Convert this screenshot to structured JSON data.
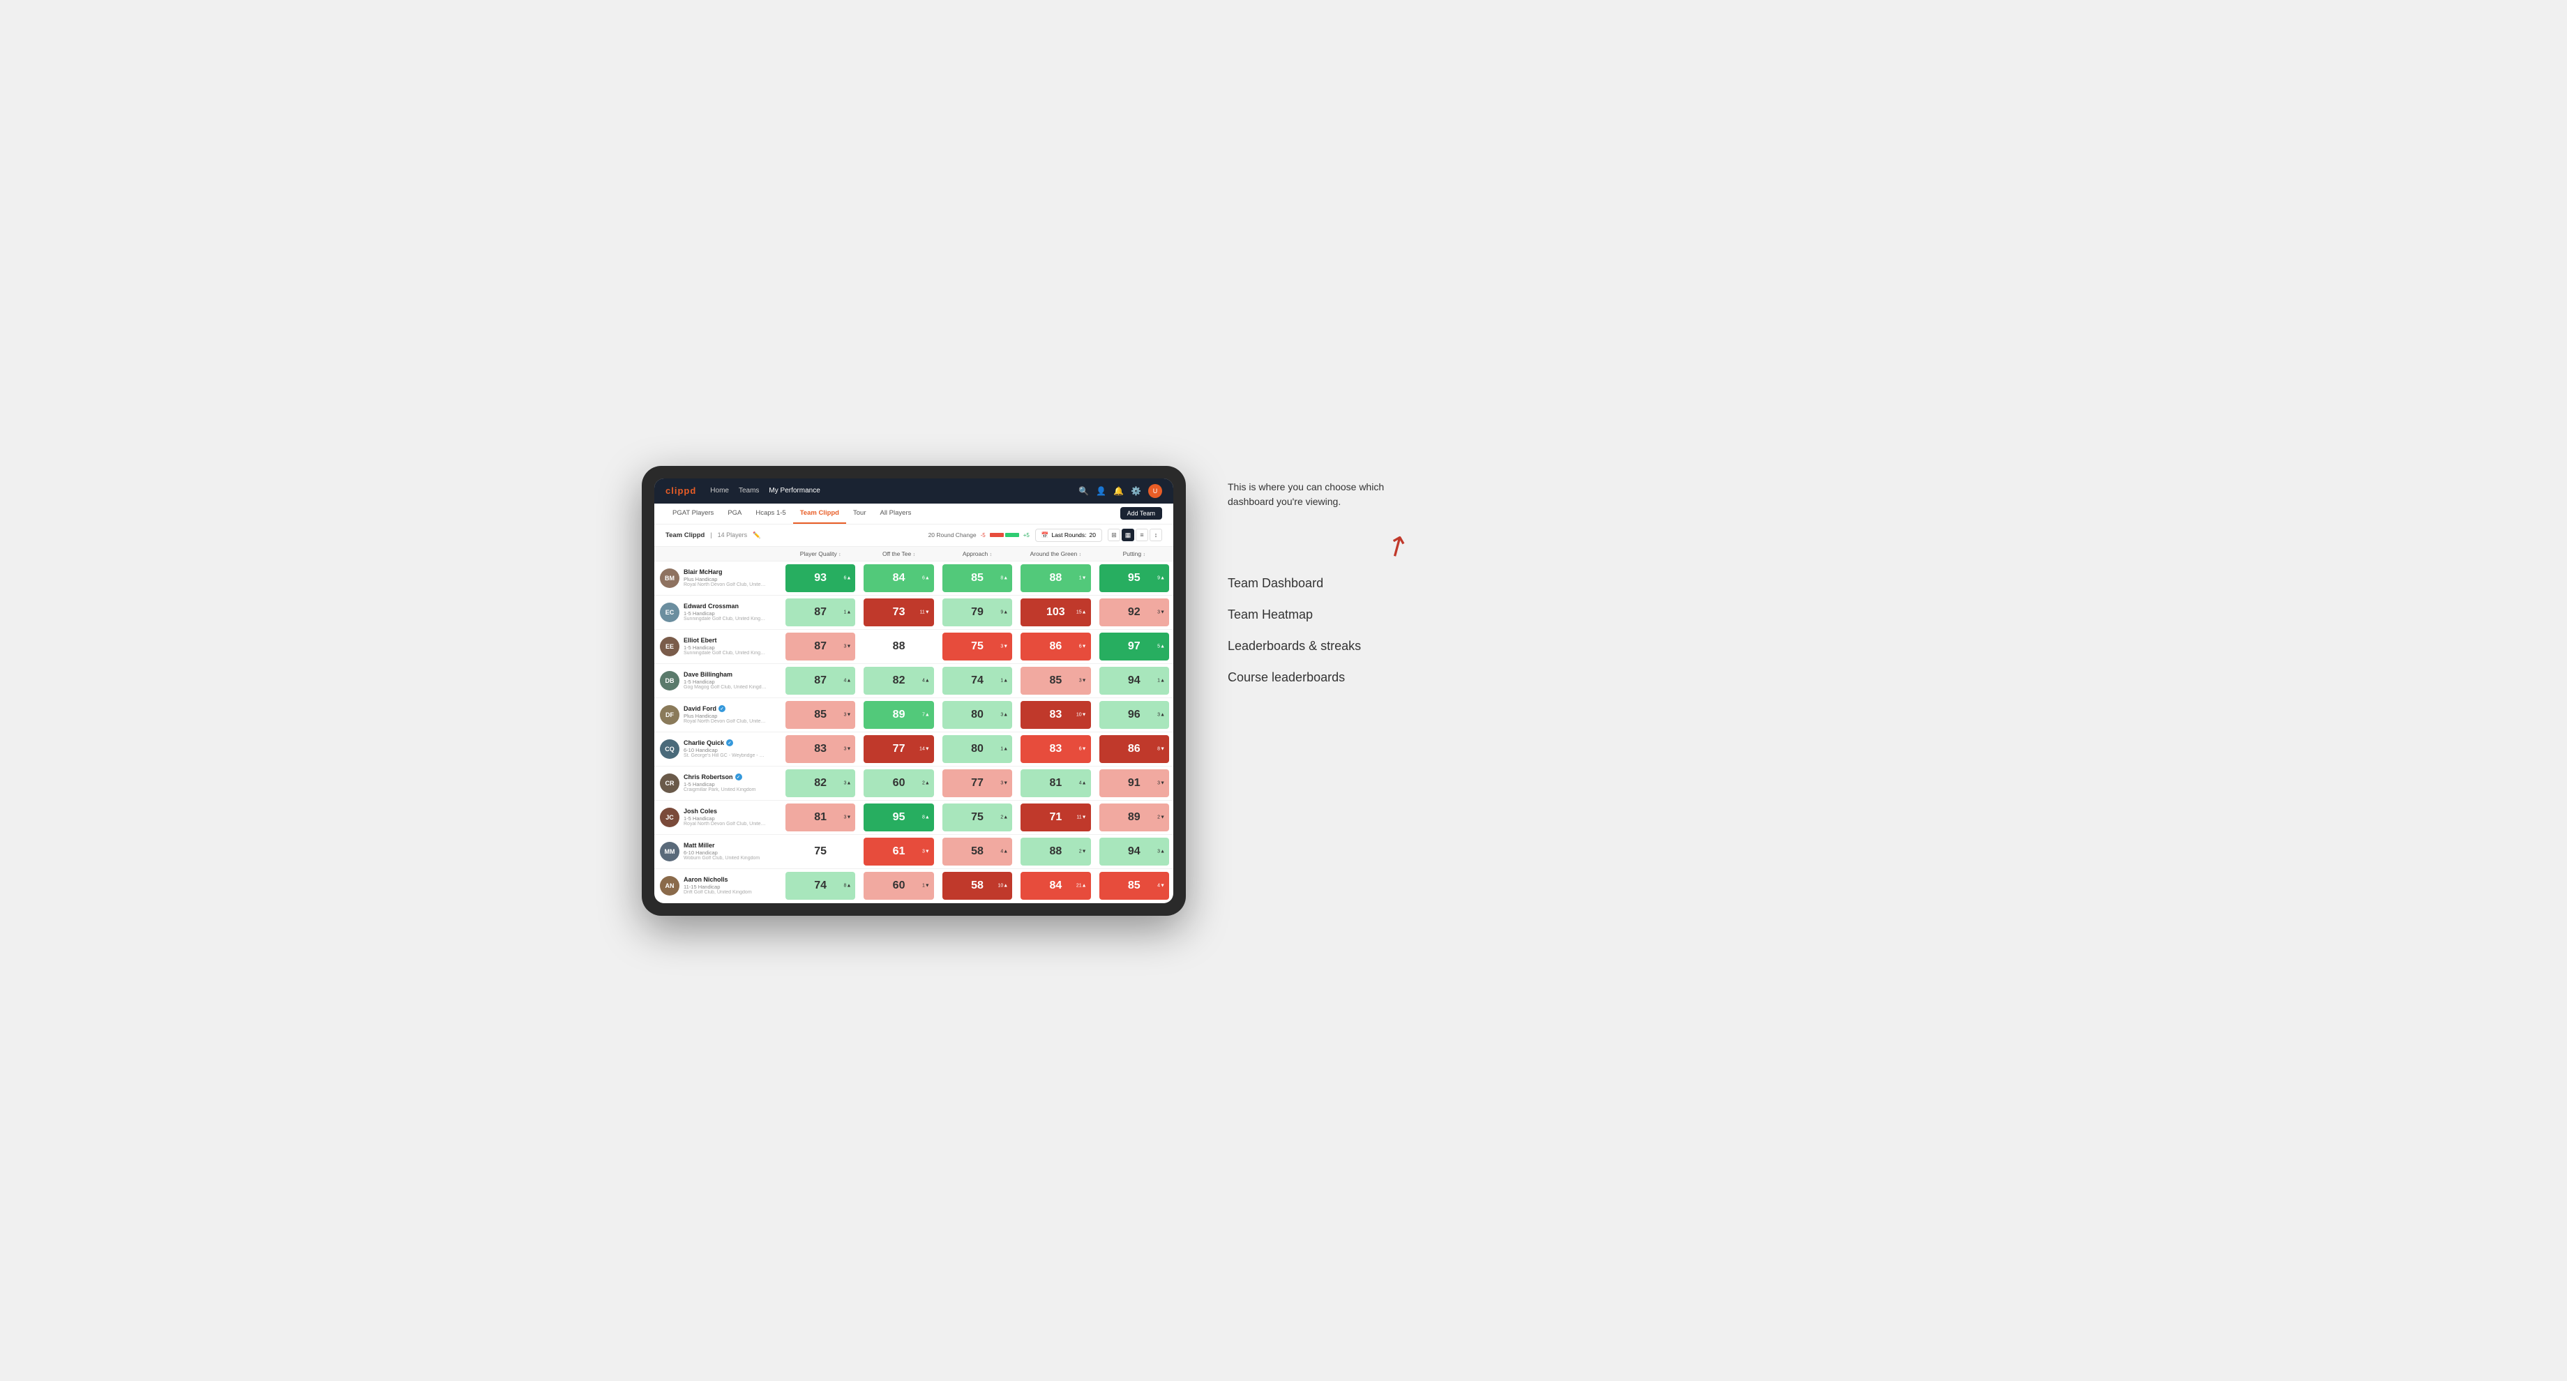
{
  "annotation": {
    "intro": "This is where you can choose which dashboard you're viewing.",
    "menu_items": [
      "Team Dashboard",
      "Team Heatmap",
      "Leaderboards & streaks",
      "Course leaderboards"
    ]
  },
  "top_nav": {
    "logo": "clippd",
    "links": [
      "Home",
      "Teams",
      "My Performance"
    ],
    "active_link": "My Performance"
  },
  "sub_nav": {
    "links": [
      "PGAT Players",
      "PGA",
      "Hcaps 1-5",
      "Team Clippd",
      "Tour",
      "All Players"
    ],
    "active": "Team Clippd",
    "add_team_label": "Add Team"
  },
  "team_header": {
    "name": "Team Clippd",
    "separator": "|",
    "count": "14 Players",
    "round_change_label": "20 Round Change",
    "neg": "-5",
    "pos": "+5",
    "last_rounds_label": "Last Rounds:",
    "last_rounds_value": "20"
  },
  "table": {
    "col_headers": [
      {
        "label": "Player Quality",
        "sortable": true
      },
      {
        "label": "Off the Tee",
        "sortable": true
      },
      {
        "label": "Approach",
        "sortable": true
      },
      {
        "label": "Around the Green",
        "sortable": true
      },
      {
        "label": "Putting",
        "sortable": true
      }
    ],
    "rows": [
      {
        "name": "Blair McHarg",
        "handicap": "Plus Handicap",
        "club": "Royal North Devon Golf Club, United Kingdom",
        "badge": false,
        "avatar_color": "#8e7260",
        "stats": [
          {
            "value": "93",
            "change": "6▲",
            "color": "green-dark"
          },
          {
            "value": "84",
            "change": "6▲",
            "color": "green-med"
          },
          {
            "value": "85",
            "change": "8▲",
            "color": "green-med"
          },
          {
            "value": "88",
            "change": "1▼",
            "color": "green-med"
          },
          {
            "value": "95",
            "change": "9▲",
            "color": "green-dark"
          }
        ]
      },
      {
        "name": "Edward Crossman",
        "handicap": "1-5 Handicap",
        "club": "Sunningdale Golf Club, United Kingdom",
        "badge": false,
        "avatar_color": "#6b8e9f",
        "stats": [
          {
            "value": "87",
            "change": "1▲",
            "color": "green-light"
          },
          {
            "value": "73",
            "change": "11▼",
            "color": "red-dark"
          },
          {
            "value": "79",
            "change": "9▲",
            "color": "green-light"
          },
          {
            "value": "103",
            "change": "15▲",
            "color": "red-dark"
          },
          {
            "value": "92",
            "change": "3▼",
            "color": "red-light"
          }
        ]
      },
      {
        "name": "Elliot Ebert",
        "handicap": "1-5 Handicap",
        "club": "Sunningdale Golf Club, United Kingdom",
        "badge": false,
        "avatar_color": "#7a5c4a",
        "stats": [
          {
            "value": "87",
            "change": "3▼",
            "color": "red-light"
          },
          {
            "value": "88",
            "change": "",
            "color": "white-cell"
          },
          {
            "value": "75",
            "change": "3▼",
            "color": "red-med"
          },
          {
            "value": "86",
            "change": "6▼",
            "color": "red-med"
          },
          {
            "value": "97",
            "change": "5▲",
            "color": "green-dark"
          }
        ]
      },
      {
        "name": "Dave Billingham",
        "handicap": "1-5 Handicap",
        "club": "Gog Magog Golf Club, United Kingdom",
        "badge": false,
        "avatar_color": "#5a7a6b",
        "stats": [
          {
            "value": "87",
            "change": "4▲",
            "color": "green-light"
          },
          {
            "value": "82",
            "change": "4▲",
            "color": "green-light"
          },
          {
            "value": "74",
            "change": "1▲",
            "color": "green-light"
          },
          {
            "value": "85",
            "change": "3▼",
            "color": "red-light"
          },
          {
            "value": "94",
            "change": "1▲",
            "color": "green-light"
          }
        ]
      },
      {
        "name": "David Ford",
        "handicap": "Plus Handicap",
        "club": "Royal North Devon Golf Club, United Kingdom",
        "badge": true,
        "avatar_color": "#8a7a5a",
        "stats": [
          {
            "value": "85",
            "change": "3▼",
            "color": "red-light"
          },
          {
            "value": "89",
            "change": "7▲",
            "color": "green-med"
          },
          {
            "value": "80",
            "change": "3▲",
            "color": "green-light"
          },
          {
            "value": "83",
            "change": "10▼",
            "color": "red-dark"
          },
          {
            "value": "96",
            "change": "3▲",
            "color": "green-light"
          }
        ]
      },
      {
        "name": "Charlie Quick",
        "handicap": "6-10 Handicap",
        "club": "St. George's Hill GC - Weybridge - Surrey, Uni...",
        "badge": true,
        "avatar_color": "#4a6a7a",
        "stats": [
          {
            "value": "83",
            "change": "3▼",
            "color": "red-light"
          },
          {
            "value": "77",
            "change": "14▼",
            "color": "red-dark"
          },
          {
            "value": "80",
            "change": "1▲",
            "color": "green-light"
          },
          {
            "value": "83",
            "change": "6▼",
            "color": "red-med"
          },
          {
            "value": "86",
            "change": "8▼",
            "color": "red-dark"
          }
        ]
      },
      {
        "name": "Chris Robertson",
        "handicap": "1-5 Handicap",
        "club": "Craigmillar Park, United Kingdom",
        "badge": true,
        "avatar_color": "#6a5a4a",
        "stats": [
          {
            "value": "82",
            "change": "3▲",
            "color": "green-light"
          },
          {
            "value": "60",
            "change": "2▲",
            "color": "green-light"
          },
          {
            "value": "77",
            "change": "3▼",
            "color": "red-light"
          },
          {
            "value": "81",
            "change": "4▲",
            "color": "green-light"
          },
          {
            "value": "91",
            "change": "3▼",
            "color": "red-light"
          }
        ]
      },
      {
        "name": "Josh Coles",
        "handicap": "1-5 Handicap",
        "club": "Royal North Devon Golf Club, United Kingdom",
        "badge": false,
        "avatar_color": "#7a4a3a",
        "stats": [
          {
            "value": "81",
            "change": "3▼",
            "color": "red-light"
          },
          {
            "value": "95",
            "change": "8▲",
            "color": "green-dark"
          },
          {
            "value": "75",
            "change": "2▲",
            "color": "green-light"
          },
          {
            "value": "71",
            "change": "11▼",
            "color": "red-dark"
          },
          {
            "value": "89",
            "change": "2▼",
            "color": "red-light"
          }
        ]
      },
      {
        "name": "Matt Miller",
        "handicap": "6-10 Handicap",
        "club": "Woburn Golf Club, United Kingdom",
        "badge": false,
        "avatar_color": "#5a6a7a",
        "stats": [
          {
            "value": "75",
            "change": "",
            "color": "white-cell"
          },
          {
            "value": "61",
            "change": "3▼",
            "color": "red-med"
          },
          {
            "value": "58",
            "change": "4▲",
            "color": "red-light"
          },
          {
            "value": "88",
            "change": "2▼",
            "color": "green-light"
          },
          {
            "value": "94",
            "change": "3▲",
            "color": "green-light"
          }
        ]
      },
      {
        "name": "Aaron Nicholls",
        "handicap": "11-15 Handicap",
        "club": "Drift Golf Club, United Kingdom",
        "badge": false,
        "avatar_color": "#8a6a4a",
        "stats": [
          {
            "value": "74",
            "change": "8▲",
            "color": "green-light"
          },
          {
            "value": "60",
            "change": "1▼",
            "color": "red-light"
          },
          {
            "value": "58",
            "change": "10▲",
            "color": "red-dark"
          },
          {
            "value": "84",
            "change": "21▲",
            "color": "red-med"
          },
          {
            "value": "85",
            "change": "4▼",
            "color": "red-med"
          }
        ]
      }
    ]
  }
}
